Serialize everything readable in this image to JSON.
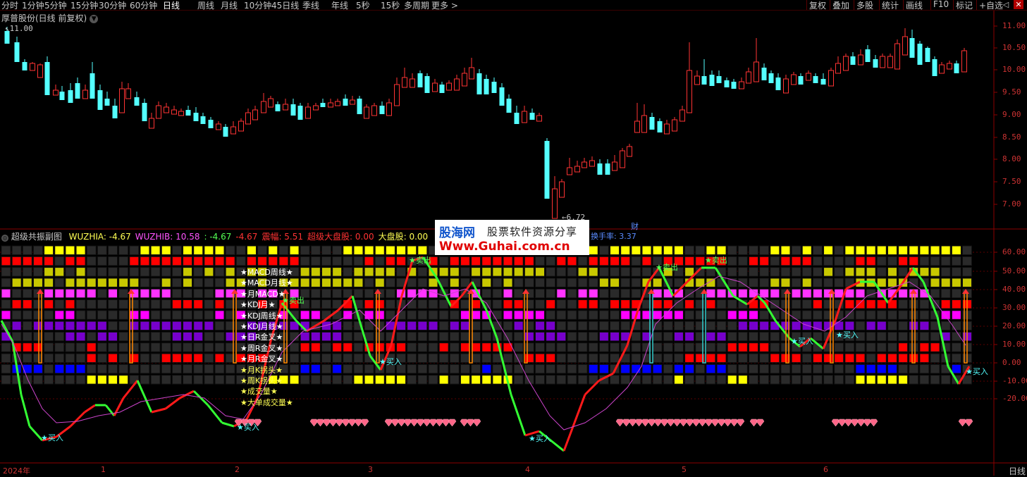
{
  "topbar": {
    "periods": [
      "分时",
      "1分钟",
      "5分钟",
      "15分钟",
      "30分钟",
      "60分钟",
      "日线",
      "周线",
      "月线",
      "10分钟",
      "45日线",
      "季线",
      "年线",
      "5秒",
      "15秒",
      "多周期",
      "更多 >"
    ],
    "active_period": "日线",
    "tools": [
      "复权",
      "叠加",
      "多股",
      "统计",
      "画线",
      "F10",
      "标记",
      "+自选"
    ],
    "window_controls": {
      "back": "◁",
      "close": "✕"
    }
  },
  "main_chart": {
    "title": "厚普股份(日线 前复权)",
    "high_label": "11.00",
    "low_label": "6.72",
    "annotation": "财",
    "y_ticks": [
      "11.00",
      "10.50",
      "10.00",
      "9.50",
      "9.00",
      "8.50",
      "8.00",
      "7.50",
      "7.00"
    ],
    "colors": {
      "up": "#ff3333",
      "down": "#54ffff"
    }
  },
  "sub_chart": {
    "title": "超级共振副图",
    "legend": [
      {
        "text": "WUZHIA: -4.67",
        "color": "#ffff54"
      },
      {
        "text": "WUZHIB: 10.58",
        "color": "#ff54ff"
      },
      {
        "text": ": -4.67",
        "color": "#54ff54"
      },
      {
        "text": "-4.67",
        "color": "#ff3333"
      },
      {
        "text": "震幅: 5.51",
        "color": "#ff3333"
      },
      {
        "text": "超级大盘股: 0.00",
        "color": "#ff3333"
      },
      {
        "text": "大盘股: 0.00",
        "color": "#ffff54"
      }
    ],
    "legend_tail": "换手率: 3.37",
    "y_ticks": [
      "60.00",
      "50.00",
      "40.00",
      "30.00",
      "20.00",
      "10.00",
      "0.00",
      "-10.00",
      "-20.00"
    ],
    "row_labels": [
      "★MACD周线★",
      "★MACD月线★",
      "★月MACD★",
      "★KDJ月★",
      "★KDJ周线★",
      "★KDJ月线★",
      "★日R金叉★",
      "★周R金叉★",
      "★月R金叉★",
      "★月K拐头★",
      "★周K拐头★",
      "★成交量★",
      "★大单成交量★"
    ],
    "signals": [
      {
        "text": "买入",
        "color": "#54ffff"
      },
      {
        "text": "买入",
        "color": "#54ffff"
      },
      {
        "text": "买入",
        "color": "#54ffff"
      },
      {
        "text": "买入",
        "color": "#54ffff"
      },
      {
        "text": "买入",
        "color": "#54ffff"
      },
      {
        "text": "买入",
        "color": "#54ffff"
      },
      {
        "text": "买入",
        "color": "#54ffff"
      },
      {
        "text": "卖出",
        "color": "#54ff54"
      },
      {
        "text": "卖出",
        "color": "#54ff54"
      },
      {
        "text": "卖出",
        "color": "#54ff54"
      },
      {
        "text": "卖出",
        "color": "#54ff54"
      }
    ]
  },
  "x_axis": {
    "labels": [
      "2024年",
      "1",
      "2",
      "3",
      "4",
      "5",
      "6"
    ],
    "frequency": "日线"
  },
  "watermark": {
    "brand": "股海网",
    "slogan": "股票软件资源分享",
    "url": "Www.Guhai.com.cn"
  }
}
